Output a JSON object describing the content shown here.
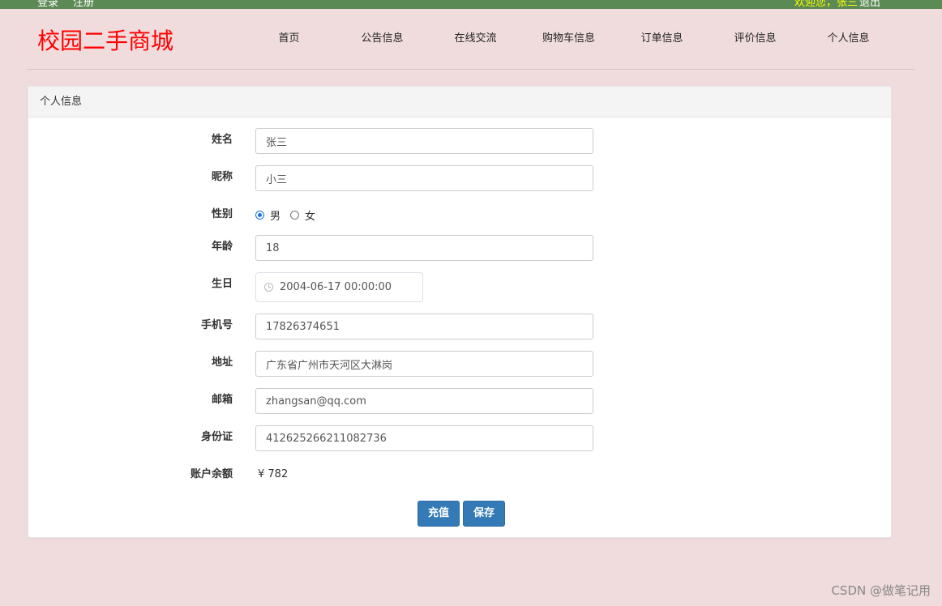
{
  "topbar": {
    "login": "登录",
    "register": "注册",
    "welcome": "欢迎您，张三",
    "logout": "退出"
  },
  "header": {
    "logo": "校园二手商城",
    "nav": [
      "首页",
      "公告信息",
      "在线交流",
      "购物车信息",
      "订单信息",
      "评价信息",
      "个人信息"
    ]
  },
  "panel": {
    "title": "个人信息"
  },
  "form": {
    "name_label": "姓名",
    "name_value": "张三",
    "nickname_label": "昵称",
    "nickname_value": "小三",
    "gender_label": "性别",
    "gender_male": "男",
    "gender_female": "女",
    "age_label": "年龄",
    "age_value": "18",
    "birthday_label": "生日",
    "birthday_value": "2004-06-17 00:00:00",
    "phone_label": "手机号",
    "phone_value": "17826374651",
    "address_label": "地址",
    "address_value": "广东省广州市天河区大淋岗",
    "email_label": "邮箱",
    "email_value": "zhangsan@qq.com",
    "idcard_label": "身份证",
    "idcard_value": "412625266211082736",
    "balance_label": "账户余额",
    "balance_value": "¥ 782",
    "recharge_button": "充值",
    "save_button": "保存"
  },
  "watermark": "CSDN @做笔记用"
}
